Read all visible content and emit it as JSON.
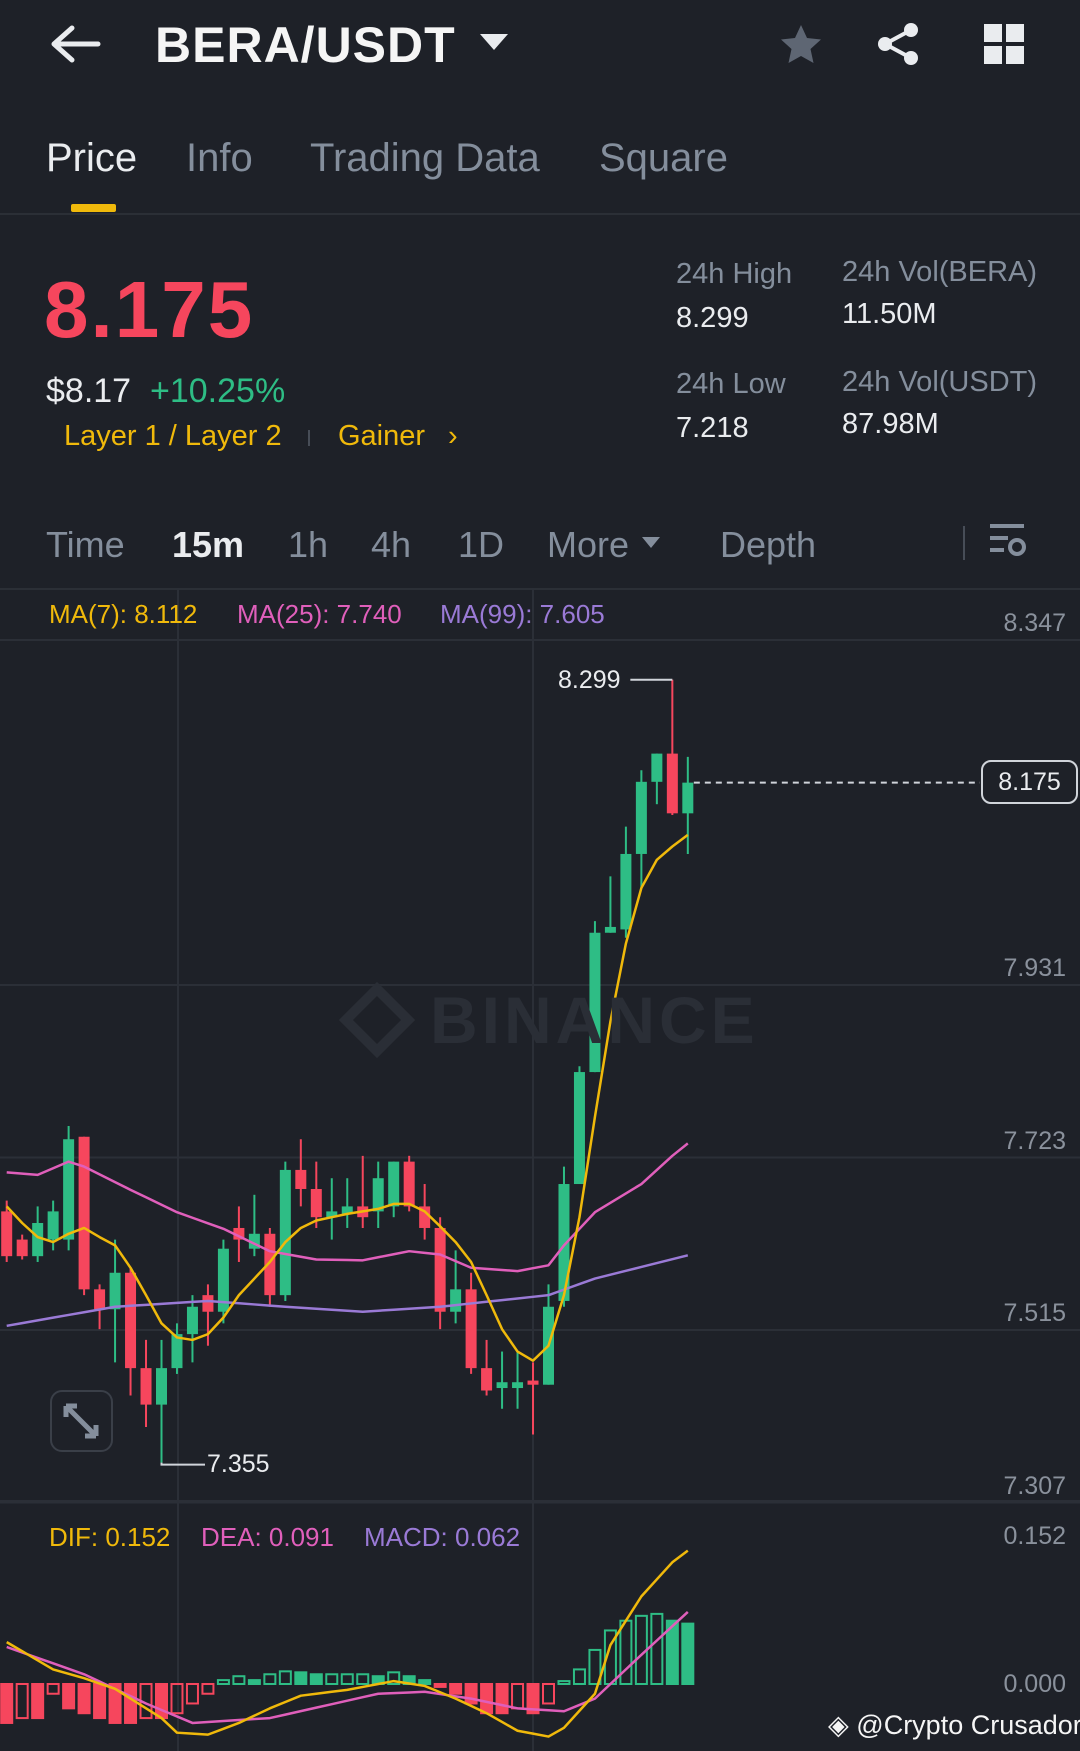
{
  "header": {
    "title": "BERA/USDT",
    "back_icon": "arrow-left",
    "icons": [
      "star-icon",
      "share-icon",
      "grid-icon"
    ]
  },
  "tabs": [
    {
      "label": "Price"
    },
    {
      "label": "Info"
    },
    {
      "label": "Trading Data"
    },
    {
      "label": "Square"
    }
  ],
  "price": {
    "last": "8.175",
    "fiat": "$8.17",
    "change": "+10.25%",
    "tag1": "Layer 1 / Layer 2",
    "tag2": "Gainer"
  },
  "stats": {
    "high_label": "24h High",
    "high": "8.299",
    "low_label": "24h Low",
    "low": "7.218",
    "vol_base_label": "24h Vol(BERA)",
    "vol_base": "11.50M",
    "vol_quote_label": "24h Vol(USDT)",
    "vol_quote": "87.98M"
  },
  "intervals": [
    {
      "label": "Time"
    },
    {
      "label": "15m"
    },
    {
      "label": "1h"
    },
    {
      "label": "4h"
    },
    {
      "label": "1D"
    },
    {
      "label": "More"
    },
    {
      "label": "Depth"
    }
  ],
  "colors": {
    "up": "#2ebd85",
    "down": "#f6465d",
    "ma7": "#f0b90b",
    "ma25": "#e05fbb",
    "ma99": "#9a7ad6"
  },
  "watermark": "BINANCE",
  "credit": "@Crypto Crusador",
  "chart_data": {
    "type": "candlestick",
    "legend": {
      "ma7": "MA(7): 8.112",
      "ma25": "MA(25): 7.740",
      "ma99": "MA(99): 7.605",
      "dif": "DIF: 0.152",
      "dea": "DEA: 0.091",
      "macd": "MACD: 0.062"
    },
    "price_ticks": [
      "8.347",
      "7.931",
      "7.723",
      "7.515",
      "7.307"
    ],
    "price_tick_values": [
      8.347,
      7.931,
      7.723,
      7.515,
      7.307
    ],
    "macd_ticks": [
      "0.152",
      "0.000"
    ],
    "high_marker": "8.299",
    "low_marker": "7.355",
    "last_price": "8.175",
    "ohlc": [
      [
        7.658,
        7.671,
        7.597,
        7.604
      ],
      [
        7.624,
        7.63,
        7.6,
        7.604
      ],
      [
        7.604,
        7.664,
        7.597,
        7.644
      ],
      [
        7.624,
        7.671,
        7.611,
        7.658
      ],
      [
        7.624,
        7.761,
        7.611,
        7.745
      ],
      [
        7.748,
        7.748,
        7.557,
        7.564
      ],
      [
        7.564,
        7.57,
        7.516,
        7.54
      ],
      [
        7.54,
        7.624,
        7.476,
        7.584
      ],
      [
        7.584,
        7.59,
        7.436,
        7.469
      ],
      [
        7.469,
        7.503,
        7.398,
        7.425
      ],
      [
        7.425,
        7.503,
        7.355,
        7.469
      ],
      [
        7.469,
        7.523,
        7.462,
        7.51
      ],
      [
        7.51,
        7.557,
        7.476,
        7.543
      ],
      [
        7.557,
        7.57,
        7.496,
        7.537
      ],
      [
        7.537,
        7.624,
        7.523,
        7.613
      ],
      [
        7.638,
        7.664,
        7.597,
        7.624
      ],
      [
        7.613,
        7.678,
        7.604,
        7.631
      ],
      [
        7.631,
        7.638,
        7.543,
        7.557
      ],
      [
        7.557,
        7.718,
        7.55,
        7.708
      ],
      [
        7.708,
        7.745,
        7.664,
        7.685
      ],
      [
        7.685,
        7.718,
        7.638,
        7.651
      ],
      [
        7.651,
        7.698,
        7.624,
        7.658
      ],
      [
        7.655,
        7.698,
        7.638,
        7.664
      ],
      [
        7.664,
        7.725,
        7.638,
        7.651
      ],
      [
        7.658,
        7.718,
        7.638,
        7.698
      ],
      [
        7.664,
        7.718,
        7.651,
        7.718
      ],
      [
        7.718,
        7.725,
        7.658,
        7.664
      ],
      [
        7.664,
        7.691,
        7.624,
        7.638
      ],
      [
        7.638,
        7.651,
        7.516,
        7.537
      ],
      [
        7.537,
        7.611,
        7.523,
        7.564
      ],
      [
        7.564,
        7.584,
        7.462,
        7.469
      ],
      [
        7.469,
        7.503,
        7.436,
        7.442
      ],
      [
        7.445,
        7.489,
        7.42,
        7.452
      ],
      [
        7.445,
        7.489,
        7.42,
        7.452
      ],
      [
        7.454,
        7.476,
        7.389,
        7.449
      ],
      [
        7.449,
        7.57,
        7.449,
        7.543
      ],
      [
        7.55,
        7.712,
        7.543,
        7.691
      ],
      [
        7.691,
        7.833,
        7.691,
        7.826
      ],
      [
        7.826,
        8.008,
        7.826,
        7.994
      ],
      [
        7.994,
        8.062,
        7.994,
        8.001
      ],
      [
        7.998,
        8.122,
        7.988,
        8.089
      ],
      [
        8.089,
        8.19,
        8.048,
        8.176
      ],
      [
        8.176,
        8.21,
        8.149,
        8.21
      ],
      [
        8.21,
        8.299,
        8.136,
        8.138
      ],
      [
        8.138,
        8.206,
        8.089,
        8.175
      ]
    ],
    "ma7": [
      7.664,
      7.644,
      7.627,
      7.621,
      7.631,
      7.638,
      7.627,
      7.617,
      7.59,
      7.557,
      7.523,
      7.506,
      7.503,
      7.51,
      7.53,
      7.557,
      7.577,
      7.597,
      7.621,
      7.638,
      7.647,
      7.651,
      7.655,
      7.658,
      7.661,
      7.667,
      7.667,
      7.658,
      7.64,
      7.621,
      7.597,
      7.557,
      7.516,
      7.489,
      7.478,
      7.496,
      7.557,
      7.651,
      7.772,
      7.887,
      7.981,
      8.048,
      8.082,
      8.098,
      8.112
    ],
    "ma25": [
      [
        0,
        7.705
      ],
      [
        2,
        7.702
      ],
      [
        4,
        7.718
      ],
      [
        5,
        7.712
      ],
      [
        8,
        7.684
      ],
      [
        11,
        7.657
      ],
      [
        14,
        7.637
      ],
      [
        17,
        7.61
      ],
      [
        20,
        7.6
      ],
      [
        23,
        7.599
      ],
      [
        26,
        7.61
      ],
      [
        28,
        7.606
      ],
      [
        30,
        7.59
      ],
      [
        33,
        7.586
      ],
      [
        35,
        7.593
      ],
      [
        36,
        7.617
      ],
      [
        38,
        7.657
      ],
      [
        41,
        7.691
      ],
      [
        43,
        7.725
      ],
      [
        44,
        7.74
      ]
    ],
    "ma99": [
      [
        0,
        7.52
      ],
      [
        7,
        7.543
      ],
      [
        13,
        7.55
      ],
      [
        18,
        7.543
      ],
      [
        23,
        7.537
      ],
      [
        28,
        7.543
      ],
      [
        35,
        7.557
      ],
      [
        38,
        7.577
      ],
      [
        44,
        7.605
      ]
    ],
    "macd_hist": [
      -0.04,
      -0.035,
      -0.035,
      -0.01,
      -0.025,
      -0.03,
      -0.035,
      -0.04,
      -0.04,
      -0.035,
      -0.035,
      -0.03,
      -0.02,
      -0.01,
      0.004,
      0.008,
      0.004,
      0.01,
      0.013,
      0.012,
      0.01,
      0.01,
      0.01,
      0.01,
      0.008,
      0.012,
      0.008,
      0.004,
      -0.003,
      -0.01,
      -0.02,
      -0.03,
      -0.03,
      -0.025,
      -0.03,
      -0.02,
      0.003,
      0.015,
      0.035,
      0.055,
      0.065,
      0.07,
      0.072,
      0.065,
      0.062
    ],
    "dif": [
      [
        0,
        0.043
      ],
      [
        3,
        0.015
      ],
      [
        5,
        0.006
      ],
      [
        7,
        -0.005
      ],
      [
        10,
        -0.035
      ],
      [
        11,
        -0.05
      ],
      [
        13,
        -0.052
      ],
      [
        15,
        -0.04
      ],
      [
        17,
        -0.025
      ],
      [
        19,
        -0.012
      ],
      [
        22,
        -0.006
      ],
      [
        25,
        0.003
      ],
      [
        27,
        -0.002
      ],
      [
        29,
        -0.015
      ],
      [
        31,
        -0.03
      ],
      [
        33,
        -0.048
      ],
      [
        35,
        -0.054
      ],
      [
        36,
        -0.045
      ],
      [
        38,
        -0.01
      ],
      [
        39,
        0.04
      ],
      [
        41,
        0.09
      ],
      [
        43,
        0.125
      ],
      [
        44,
        0.137
      ]
    ],
    "dea": [
      [
        0,
        0.038
      ],
      [
        5,
        0.01
      ],
      [
        9,
        -0.02
      ],
      [
        12,
        -0.04
      ],
      [
        17,
        -0.035
      ],
      [
        24,
        -0.01
      ],
      [
        27,
        -0.008
      ],
      [
        30,
        -0.015
      ],
      [
        33,
        -0.025
      ],
      [
        36,
        -0.028
      ],
      [
        38,
        -0.015
      ],
      [
        41,
        0.03
      ],
      [
        44,
        0.074
      ]
    ]
  }
}
